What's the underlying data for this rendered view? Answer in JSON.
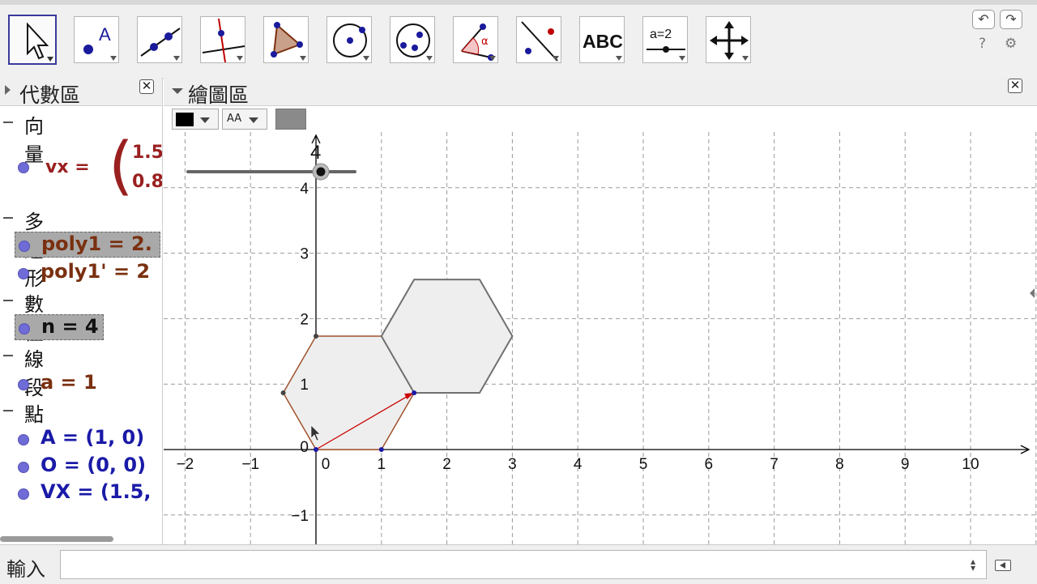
{
  "toolbar": {
    "tools": [
      {
        "id": "move",
        "icon": "cursor-arrow-icon",
        "selected": true
      },
      {
        "id": "point",
        "icon": "point-icon",
        "letter": "A"
      },
      {
        "id": "line",
        "icon": "line-through-two-points-icon"
      },
      {
        "id": "perpendicular",
        "icon": "perpendicular-line-icon"
      },
      {
        "id": "polygon",
        "icon": "polygon-icon"
      },
      {
        "id": "circle",
        "icon": "circle-center-point-icon"
      },
      {
        "id": "conic",
        "icon": "ellipse-icon"
      },
      {
        "id": "angle",
        "icon": "angle-icon",
        "letter": "α"
      },
      {
        "id": "reflect",
        "icon": "reflect-about-line-icon"
      },
      {
        "id": "text",
        "icon": "text-icon",
        "letter": "ABC"
      },
      {
        "id": "slider",
        "icon": "slider-icon",
        "letter": "a=2"
      },
      {
        "id": "move-graphics",
        "icon": "move-graphics-view-icon"
      }
    ],
    "undo_icon": "undo-icon",
    "redo_icon": "redo-icon",
    "help_icon": "help-icon",
    "settings_icon": "gear-icon",
    "help_glyph": "?",
    "settings_glyph": "⚙"
  },
  "algebra": {
    "title": "代數區",
    "categories": {
      "vector": "向量",
      "polygon": "多邊形",
      "number": "數值",
      "segment": "線段",
      "point": "點"
    },
    "vector_name": "vx  =",
    "vector_x": "1.5",
    "vector_y": "0.8",
    "items": {
      "poly1": "poly1 = 2.",
      "poly1p": "poly1' = 2",
      "n": "n = 4",
      "a": "a = 1",
      "A": "A = (1, 0)",
      "O": "O = (0, 0)",
      "VX": "VX = (1.5,"
    }
  },
  "graphics": {
    "title": "繪圖區",
    "style_text_btn": "AA",
    "x_ticks": [
      "−2",
      "−1",
      "0",
      "1",
      "2",
      "3",
      "4",
      "5",
      "6",
      "7",
      "8",
      "9",
      "10"
    ],
    "y_ticks": [
      "−1",
      "0",
      "1",
      "2",
      "3",
      "4"
    ],
    "slider_value": "4",
    "colors": {
      "grid": "#999999",
      "axis": "#000000",
      "polygon_fill": "#eeeeee",
      "poly1_stroke": "#a0522d",
      "poly2_stroke": "#707070",
      "vector": "#cc0000",
      "point": "#1a1aa8"
    }
  },
  "inputbar": {
    "label": "輸入",
    "value": ""
  }
}
